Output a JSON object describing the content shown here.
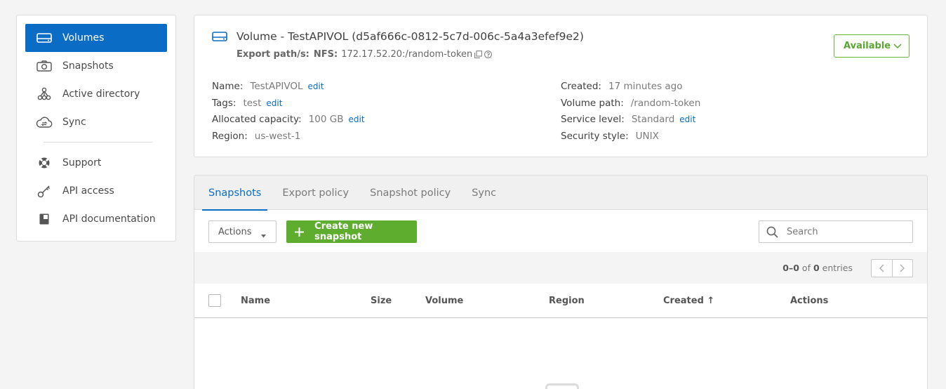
{
  "sidebar": {
    "primary": [
      {
        "label": "Volumes",
        "icon": "drive-icon",
        "active": true
      },
      {
        "label": "Snapshots",
        "icon": "camera-icon"
      },
      {
        "label": "Active directory",
        "icon": "directory-tree-icon"
      },
      {
        "label": "Sync",
        "icon": "cloud-sync-icon"
      }
    ],
    "secondary": [
      {
        "label": "Support",
        "icon": "lifebuoy-icon"
      },
      {
        "label": "API access",
        "icon": "key-icon"
      },
      {
        "label": "API documentation",
        "icon": "book-icon"
      }
    ]
  },
  "volume": {
    "title": "Volume - TestAPIVOL (d5af666c-0812-5c7d-006c-5a4a3efef9e2)",
    "export_label": "Export path/s:",
    "export_protocol": "NFS:",
    "export_value": "172.17.52.20:/random-token",
    "status": "Available",
    "details_left": [
      {
        "label": "Name:",
        "value": "TestAPIVOL",
        "edit": "edit"
      },
      {
        "label": "Tags:",
        "value": "test",
        "edit": "edit"
      },
      {
        "label": "Allocated capacity:",
        "value": "100 GB",
        "edit": "edit"
      },
      {
        "label": "Region:",
        "value": "us-west-1",
        "edit": ""
      }
    ],
    "details_right": [
      {
        "label": "Created:",
        "value": "17 minutes ago",
        "edit": ""
      },
      {
        "label": "Volume path:",
        "value": "/random-token",
        "edit": ""
      },
      {
        "label": "Service level:",
        "value": "Standard",
        "edit": "edit"
      },
      {
        "label": "Security style:",
        "value": "UNIX",
        "edit": ""
      }
    ]
  },
  "tabs": [
    "Snapshots",
    "Export policy",
    "Snapshot policy",
    "Sync"
  ],
  "active_tab": "Snapshots",
  "toolbar": {
    "actions_label": "Actions",
    "create_label": "Create new snapshot",
    "search_placeholder": "Search"
  },
  "pager": {
    "range": "0–0",
    "of_text": "of",
    "total": "0",
    "entries_text": "entries"
  },
  "table": {
    "columns": [
      "Name",
      "Size",
      "Volume",
      "Region",
      "Created ↑",
      "Actions"
    ]
  },
  "colors": {
    "accent": "#0a6cc4",
    "success": "#5fad2f"
  }
}
